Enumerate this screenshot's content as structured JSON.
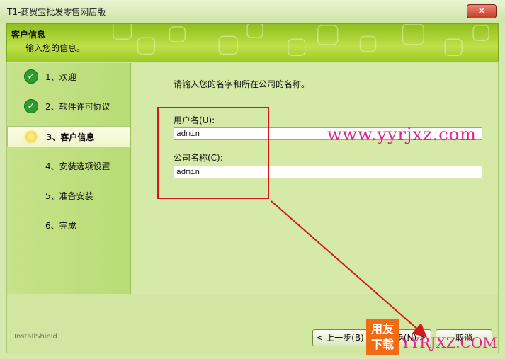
{
  "window": {
    "title": "T1-商贸宝批发零售网店版",
    "close_glyph": "✕"
  },
  "header": {
    "title": "客户信息",
    "subtitle": "输入您的信息。"
  },
  "steps": [
    {
      "label": "1、欢迎",
      "state": "done"
    },
    {
      "label": "2、软件许可协议",
      "state": "done"
    },
    {
      "label": "3、客户信息",
      "state": "active"
    },
    {
      "label": "4、安装选项设置",
      "state": "pending"
    },
    {
      "label": "5、准备安装",
      "state": "pending"
    },
    {
      "label": "6、完成",
      "state": "pending"
    }
  ],
  "form": {
    "prompt": "请输入您的名字和所在公司的名称。",
    "username_label": "用户名(U):",
    "username_value": "admin",
    "company_label": "公司名称(C):",
    "company_value": "admin"
  },
  "footer": {
    "brand": "InstallShield",
    "back_label": "< 上一步(B)",
    "next_label": "下一步(N) >",
    "cancel_label": "取消"
  },
  "watermark": {
    "text": "www.yyrjxz.com",
    "logo_top": "用友",
    "logo_bottom": "下载",
    "logo_text": "YYRJXZ.COM"
  },
  "colors": {
    "annotation_red": "#d11a1a",
    "watermark_pink": "#e0238b",
    "header_green": "#9ccb23"
  },
  "icons": {
    "done": "check-circle-icon",
    "active": "sun-icon"
  }
}
